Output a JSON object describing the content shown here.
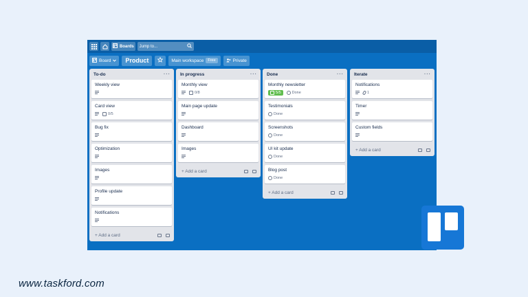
{
  "topbar": {
    "boards_label": "Boards",
    "search_placeholder": "Jump to..."
  },
  "boardbar": {
    "view_label": "Board",
    "board_name": "Product",
    "workspace_label": "Main workspace",
    "workspace_badge": "Free",
    "visibility_label": "Private"
  },
  "lists": [
    {
      "title": "To-do",
      "cards": [
        {
          "title": "Weekly view",
          "desc": true
        },
        {
          "title": "Card view",
          "desc": true,
          "checklist": "0/5"
        },
        {
          "title": "Bug fix",
          "desc": true
        },
        {
          "title": "Optimization",
          "desc": true
        },
        {
          "title": "Images",
          "desc": true
        },
        {
          "title": "Profile update",
          "desc": true
        },
        {
          "title": "Notifications",
          "desc": true
        }
      ]
    },
    {
      "title": "In progress",
      "cards": [
        {
          "title": "Monthly view",
          "desc": true,
          "checklist": "0/8"
        },
        {
          "title": "Main page update",
          "desc": true
        },
        {
          "title": "Dashboard",
          "desc": true
        },
        {
          "title": "Images",
          "desc": true
        }
      ]
    },
    {
      "title": "Done",
      "cards": [
        {
          "title": "Monthly newsletter",
          "checklist_done": "5/5",
          "status": "Done"
        },
        {
          "title": "Testimonials",
          "status": "Done"
        },
        {
          "title": "Screenshots",
          "status": "Done"
        },
        {
          "title": "UI kit update",
          "status": "Done"
        },
        {
          "title": "Blog post",
          "status": "Done"
        }
      ]
    },
    {
      "title": "Iterate",
      "cards": [
        {
          "title": "Notifications",
          "desc": true,
          "attachments": "1"
        },
        {
          "title": "Timer",
          "desc": true
        },
        {
          "title": "Custom fields",
          "desc": true
        }
      ]
    }
  ],
  "add_card_label": "+ Add a card",
  "list_menu": "···",
  "watermark": "www.taskford.com",
  "colors": {
    "board_bg": "#0a6fc2",
    "list_bg": "#e2e4e9",
    "done_green": "#61bd4f",
    "logo_blue": "#1677d6"
  }
}
